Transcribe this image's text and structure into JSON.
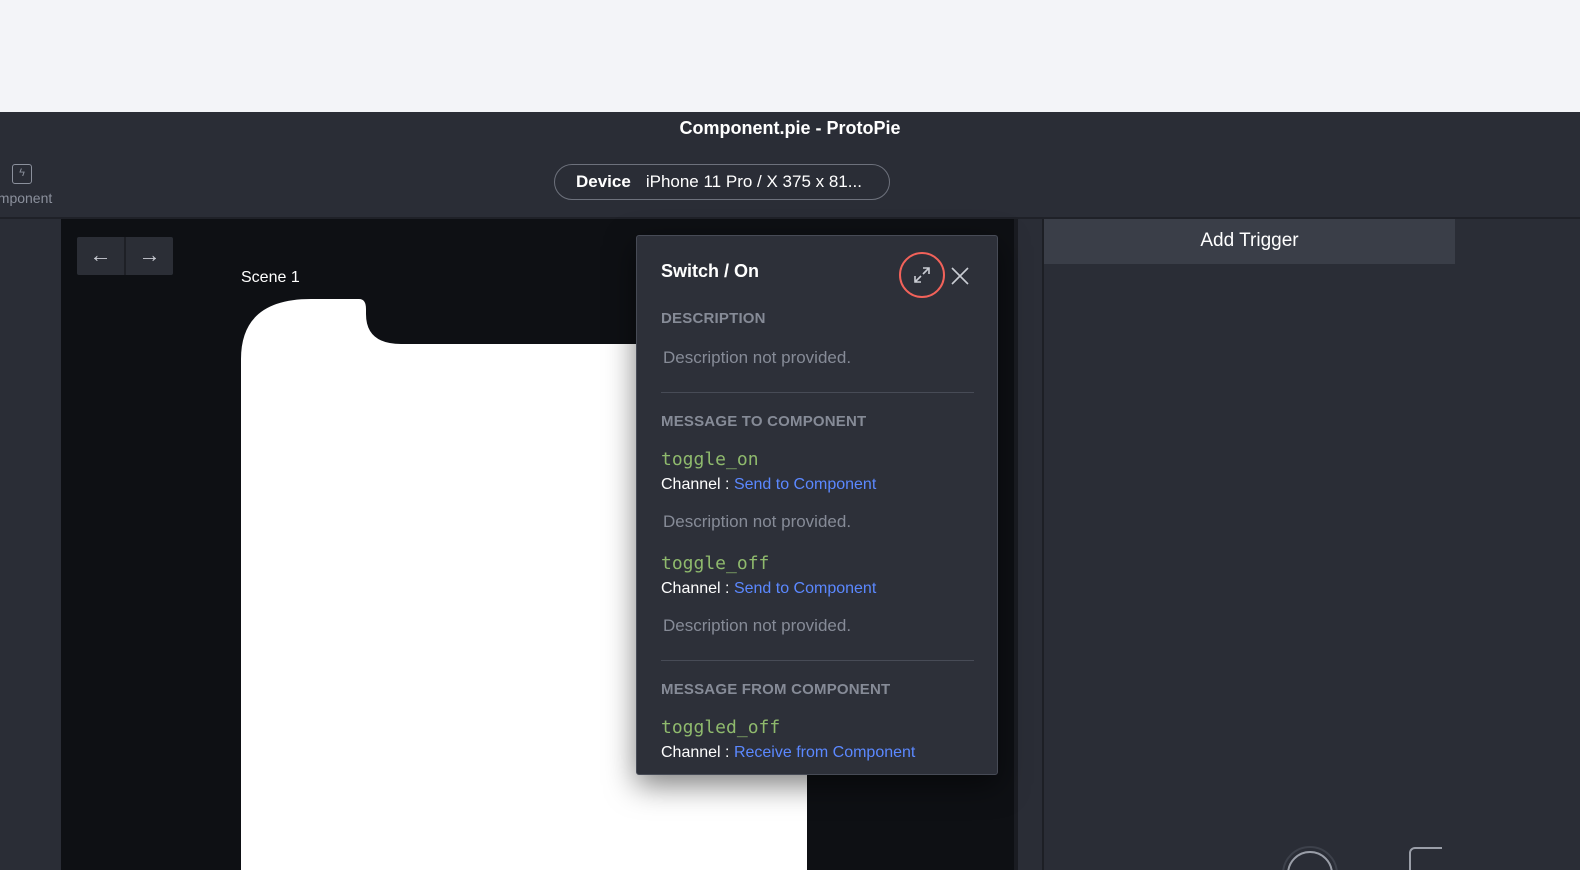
{
  "window": {
    "title": "Component.pie - ProtoPie"
  },
  "toolbar": {
    "component_label": "omponent",
    "component_icon": "bolt-icon"
  },
  "device": {
    "label": "Device",
    "value": "iPhone 11 Pro / X  375 x 81..."
  },
  "canvas": {
    "back_icon": "←",
    "forward_icon": "→",
    "scene_label": "Scene 1"
  },
  "right_panel": {
    "add_trigger": "Add Trigger"
  },
  "popup": {
    "title": "Switch / On",
    "description_heading": "DESCRIPTION",
    "description_text": "Description not provided.",
    "message_to_heading": "MESSAGE TO COMPONENT",
    "messages_to": [
      {
        "name": "toggle_on",
        "channel_label": "Channel :",
        "channel": "Send to Component",
        "description": "Description not provided."
      },
      {
        "name": "toggle_off",
        "channel_label": "Channel :",
        "channel": "Send to Component",
        "description": "Description not provided."
      }
    ],
    "message_from_heading": "MESSAGE FROM COMPONENT",
    "messages_from": [
      {
        "name": "toggled_off",
        "channel_label": "Channel :",
        "channel": "Receive from Component"
      }
    ]
  },
  "colors": {
    "app_bg": "#2a2d36",
    "canvas_bg": "#0e1014",
    "accent_link": "#5b88ff",
    "code_green": "#8fba6d",
    "highlight_ring": "#f2625a"
  }
}
